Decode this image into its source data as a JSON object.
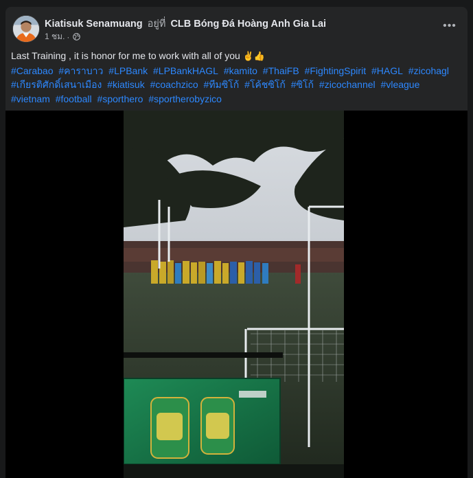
{
  "post": {
    "author": "Kiatisuk Senamuang",
    "at_word": "อยู่ที่",
    "place": "CLB Bóng Đá Hoàng Anh Gia Lai",
    "time": "1 ชม.",
    "separator": "·",
    "privacy_icon": "globe-icon",
    "more_icon": "more-options-icon",
    "more_glyph": "•••",
    "text": "Last Training , it is honor for me to work with all of you",
    "emojis": "✌👍",
    "hashtags": [
      "#Carabao",
      "#คาราบาว",
      "#LPBank",
      "#LPBankHAGL",
      "#kamito",
      "#ThaiFB",
      "#FightingSpirit",
      "#HAGL",
      "#zicohagl",
      "#เกียรติศักดิ์เสนาเมือง",
      "#kiatisuk",
      "#coachzico",
      "#ทีมซิโก้",
      "#โค้ชซิโก้",
      "#ซิโก้",
      "#zicochannel",
      "#vleague",
      "#vietnam",
      "#football",
      "#sporthero",
      "#sportherobyzico"
    ]
  },
  "colors": {
    "background": "#18191a",
    "card": "#242526",
    "text": "#e4e6eb",
    "secondary_text": "#b0b3b8",
    "link": "#2d88ff"
  }
}
